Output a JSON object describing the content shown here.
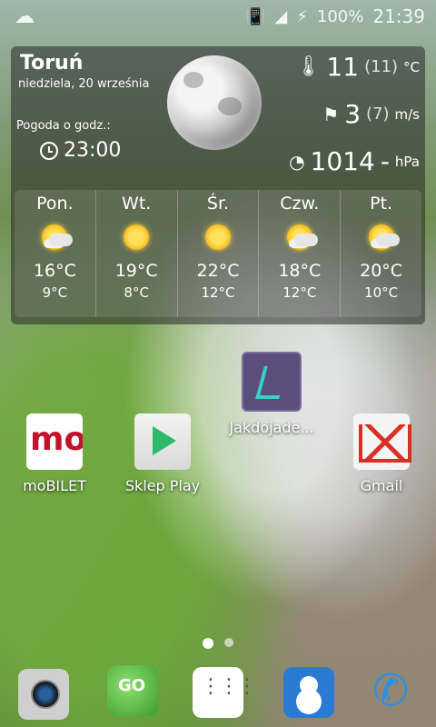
{
  "status": {
    "battery": "100%",
    "time": "21:39"
  },
  "widget": {
    "city": "Toruń",
    "date": "niedziela, 20 września",
    "pogoda_label": "Pogoda o godz.:",
    "update_time": "23:00",
    "temperature": "11",
    "feels_like": "(11)",
    "temp_unit": "°C",
    "wind": "3",
    "wind_paren": "(7)",
    "wind_unit": "m/s",
    "pressure": "1014",
    "pressure_arrow": "-",
    "pressure_unit": "hPa",
    "forecast": [
      {
        "day": "Pon.",
        "hi": "16°C",
        "lo": "9°C",
        "icon": "sun-cloud-icon"
      },
      {
        "day": "Wt.",
        "hi": "19°C",
        "lo": "8°C",
        "icon": "sun-icon"
      },
      {
        "day": "Śr.",
        "hi": "22°C",
        "lo": "12°C",
        "icon": "sun-icon"
      },
      {
        "day": "Czw.",
        "hi": "18°C",
        "lo": "12°C",
        "icon": "sun-cloud-icon"
      },
      {
        "day": "Pt.",
        "hi": "20°C",
        "lo": "10°C",
        "icon": "sun-cloud-rain-icon"
      }
    ]
  },
  "apps": {
    "jakdojade": "Jakdojade...",
    "mobilet": "moBILET",
    "play": "Sklep Play",
    "gmail": "Gmail"
  },
  "dock": [
    "camera-icon",
    "go-sms-icon",
    "app-drawer-icon",
    "contacts-icon",
    "phone-icon"
  ]
}
